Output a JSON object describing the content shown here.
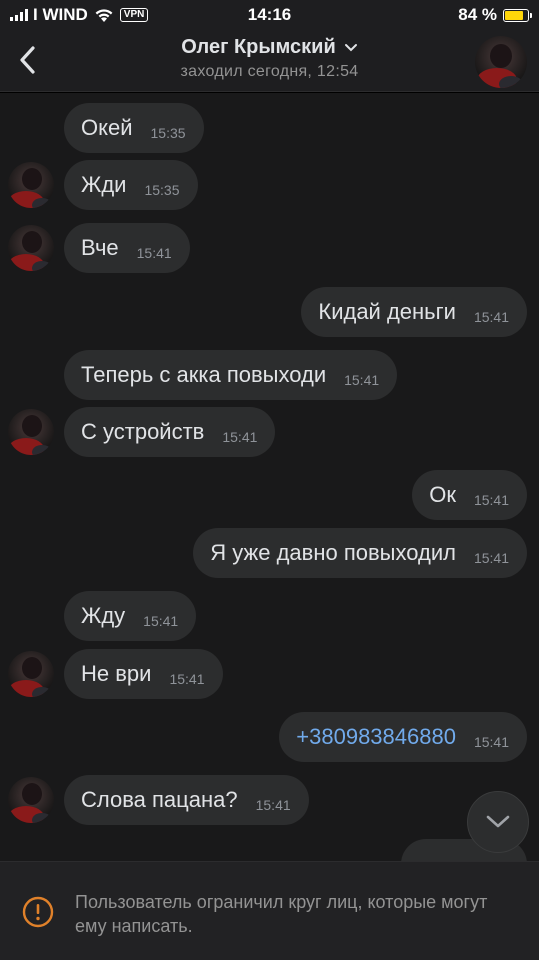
{
  "status_bar": {
    "carrier": "I WIND",
    "vpn": "VPN",
    "time": "14:16",
    "battery_percent": "84 %",
    "battery_level": 0.84
  },
  "header": {
    "name": "Олег Крымский",
    "last_seen": "заходил сегодня, 12:54"
  },
  "messages": [
    {
      "dir": "in",
      "text": "Окей",
      "time": "15:35",
      "avatar": false
    },
    {
      "dir": "in",
      "text": "Жди",
      "time": "15:35",
      "avatar": true
    },
    {
      "dir": "in",
      "text": "Вче",
      "time": "15:41",
      "avatar": true
    },
    {
      "dir": "out",
      "text": "Кидай деньги",
      "time": "15:41"
    },
    {
      "dir": "in",
      "text": "Теперь с акка повыходи",
      "time": "15:41",
      "avatar": false
    },
    {
      "dir": "in",
      "text": "С устройств",
      "time": "15:41",
      "avatar": true
    },
    {
      "dir": "out",
      "text": "Ок",
      "time": "15:41"
    },
    {
      "dir": "out",
      "text": "Я уже давно повыходил",
      "time": "15:41"
    },
    {
      "dir": "in",
      "text": "Жду",
      "time": "15:41",
      "avatar": false
    },
    {
      "dir": "in",
      "text": "Не ври",
      "time": "15:41",
      "avatar": true
    },
    {
      "dir": "out",
      "text": "+380983846880",
      "time": "15:41",
      "link": true
    },
    {
      "dir": "in",
      "text": "Слова пацана?",
      "time": "15:41",
      "avatar": true
    }
  ],
  "notice": {
    "text": "Пользователь ограничил круг лиц, которые могут ему написать."
  },
  "colors": {
    "background": "#19191a",
    "bubble": "#2c2d2e",
    "link": "#71aaeb",
    "warning": "#e0812a",
    "battery": "#ffd60a"
  }
}
